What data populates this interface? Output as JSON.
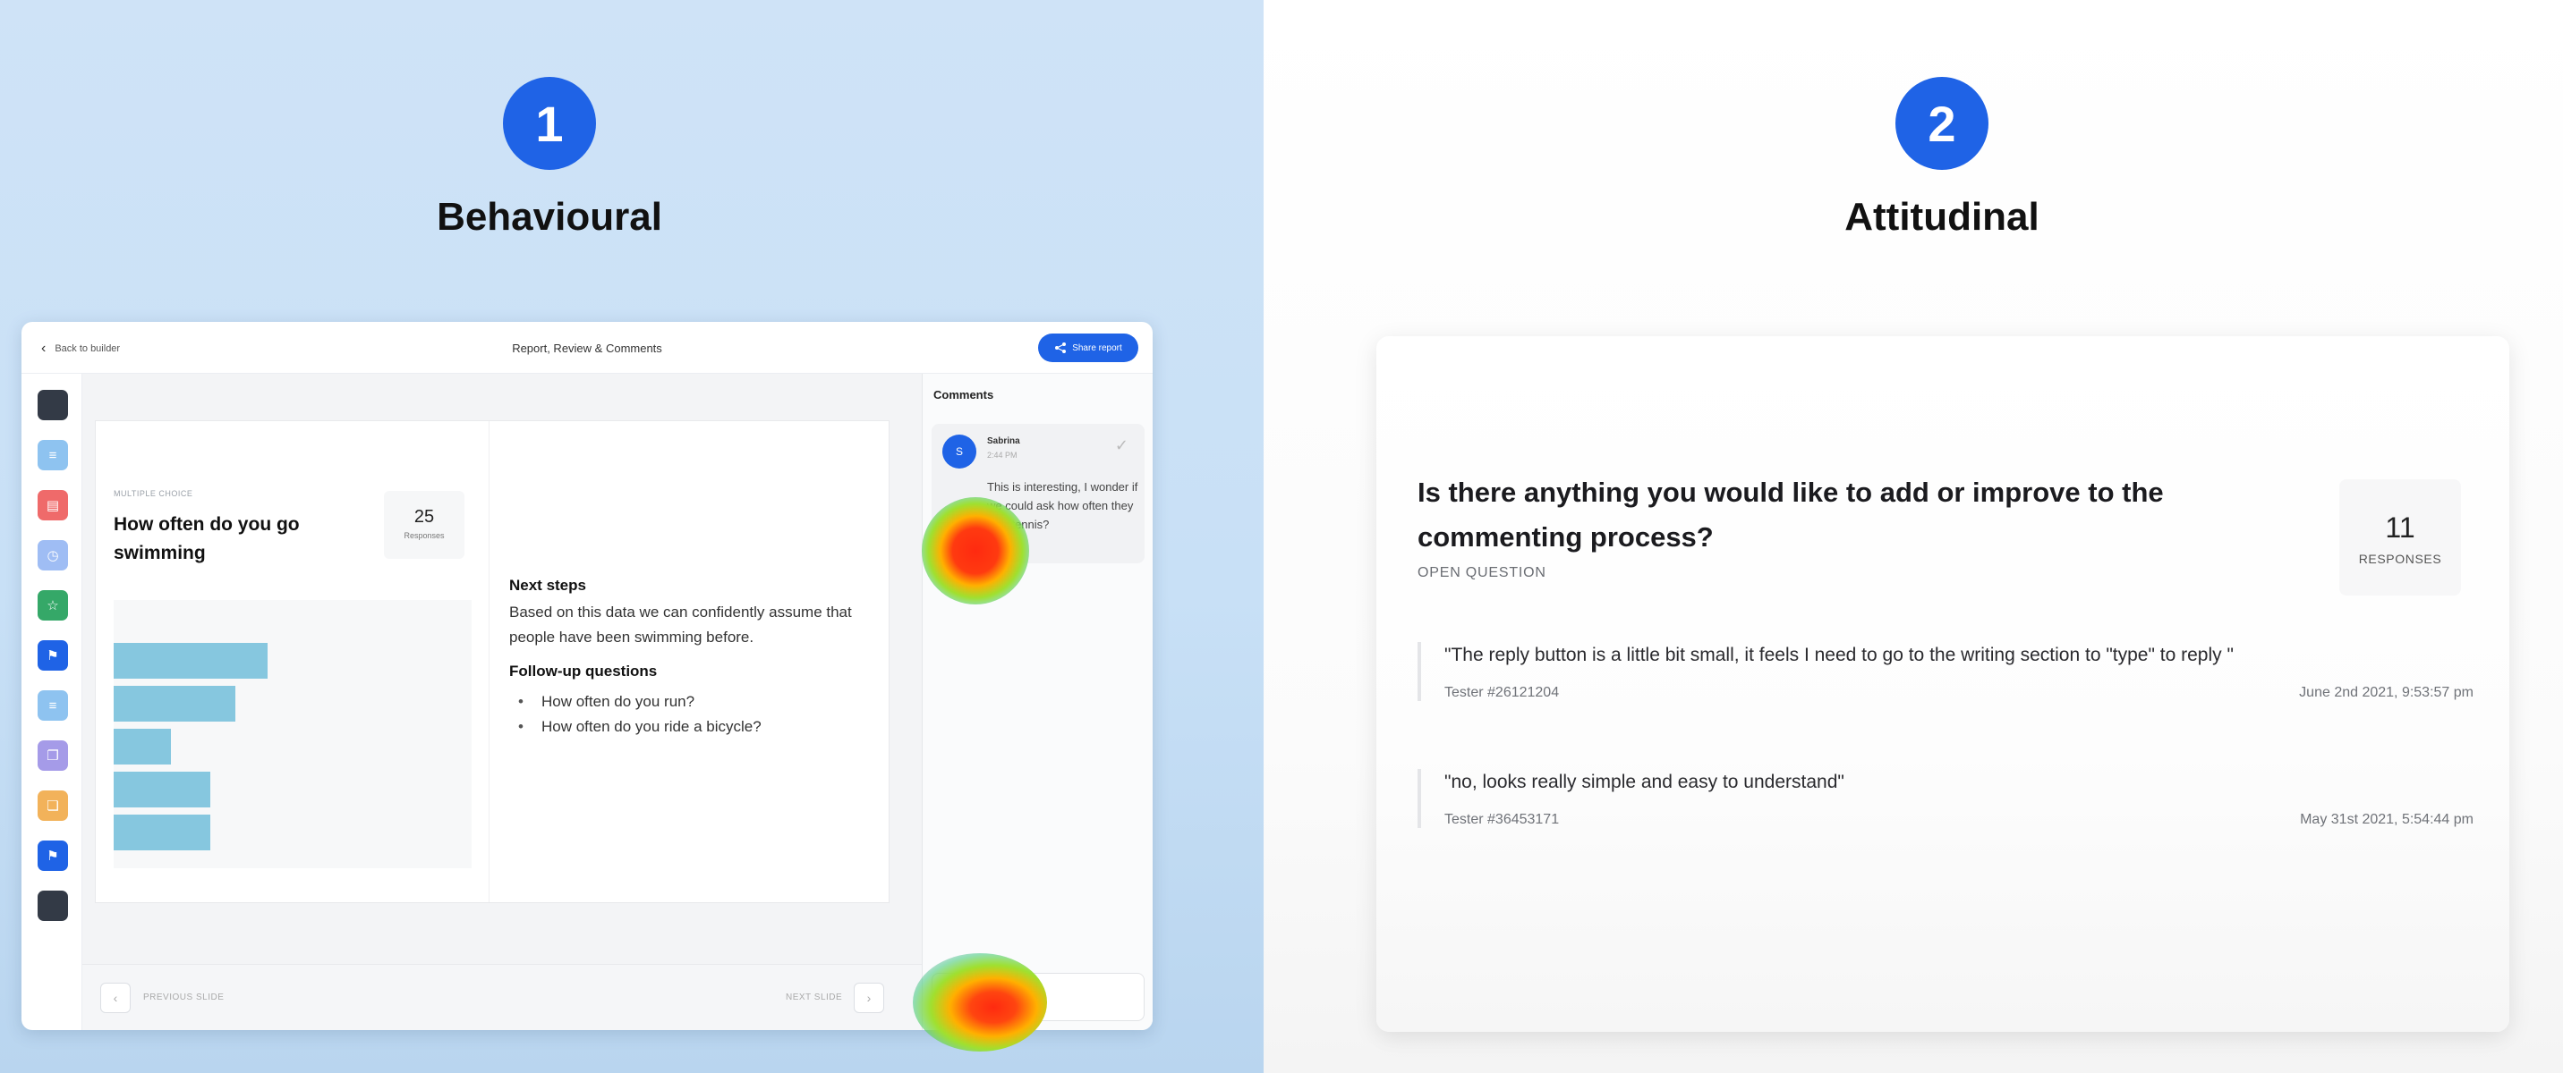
{
  "steps": [
    {
      "number": "1",
      "title": "Behavioural"
    },
    {
      "number": "2",
      "title": "Attitudinal"
    }
  ],
  "behavioural_app": {
    "back_label": "Back to builder",
    "title": "Report, Review & Comments",
    "share_label": "Share report",
    "rail_icons": [
      "dark-block-icon",
      "list-icon",
      "form-icon",
      "stopwatch-icon",
      "star-icon",
      "flag-icon",
      "list-icon",
      "files-icon",
      "copy-icon",
      "flag-icon",
      "dark-block-icon"
    ],
    "rail_colors": [
      "#333a46",
      "#8ec3f0",
      "#ef6a6a",
      "#9fbdf4",
      "#35a868",
      "#1f63e6",
      "#8ec3f0",
      "#a59be8",
      "#f2b25a",
      "#1f63e6",
      "#333a46"
    ],
    "slide": {
      "tag": "MULTIPLE CHOICE",
      "question": "How often do you go swimming",
      "responses_count": "25",
      "responses_label": "Responses",
      "bar_values": [
        0.43,
        0.34,
        0.16,
        0.27,
        0.27
      ],
      "next_steps_heading": "Next steps",
      "next_steps_body": "Based on this data we can confidently assume that people have been swimming before.",
      "followup_heading": "Follow-up questions",
      "followup_items": [
        "How often do you run?",
        "How often do you ride a bicycle?"
      ]
    },
    "footer": {
      "prev_label": "PREVIOUS SLIDE",
      "next_label": "NEXT SLIDE"
    },
    "comments": {
      "heading": "Comments",
      "author": "Sabrina",
      "avatar_initial": "S",
      "time": "2:44 PM",
      "text": "This is interesting, I wonder if we could ask how often they play tennis?"
    }
  },
  "attitudinal_card": {
    "question": "Is there anything you would like to add or improve to the commenting process?",
    "tag": "OPEN QUESTION",
    "responses_count": "11",
    "responses_label": "RESPONSES",
    "answers": [
      {
        "text": "\"The reply button is a little bit small, it feels I need to go to the writing section to \"type\" to reply \"",
        "tester": "Tester #26121204",
        "date": "June 2nd 2021, 9:53:57 pm"
      },
      {
        "text": "\"no, looks really simple and easy to understand\"",
        "tester": "Tester #36453171",
        "date": "May 31st 2021, 5:54:44 pm"
      }
    ]
  },
  "colors": {
    "accent": "#1f63e6",
    "bar": "#86c7df"
  }
}
